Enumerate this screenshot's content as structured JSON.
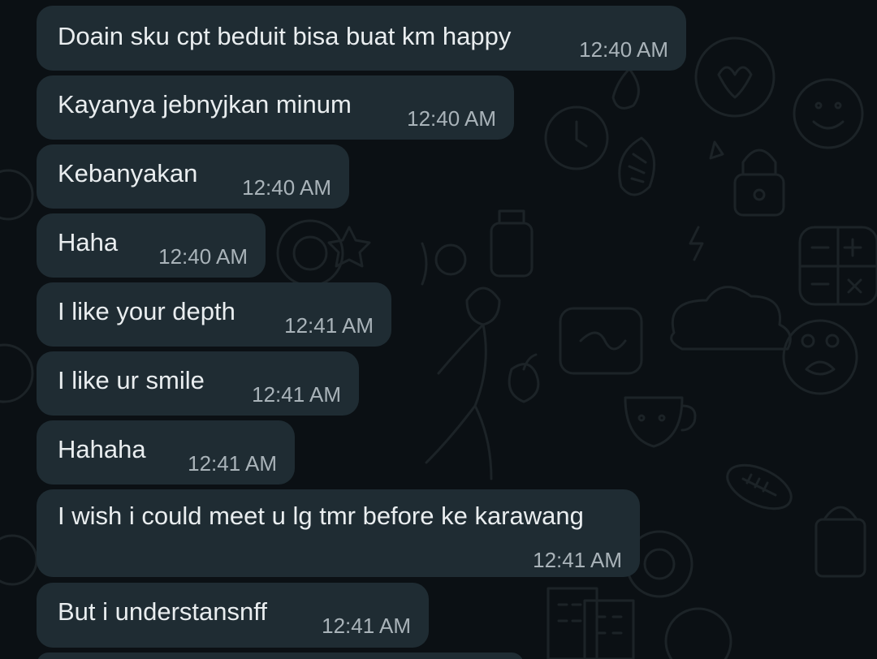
{
  "theme": {
    "background": "#0b1014",
    "bubble_incoming": "#1f2c33",
    "text": "#e9edef",
    "timestamp": "#a9b3b9"
  },
  "messages": [
    {
      "text": "Doain sku cpt beduit bisa buat km happy",
      "time": "12:40 AM",
      "direction": "incoming"
    },
    {
      "text": "Kayanya jebnyjkan minum",
      "time": "12:40 AM",
      "direction": "incoming"
    },
    {
      "text": "Kebanyakan",
      "time": "12:40 AM",
      "direction": "incoming"
    },
    {
      "text": "Haha",
      "time": "12:40 AM",
      "direction": "incoming"
    },
    {
      "text": "I like your depth",
      "time": "12:41 AM",
      "direction": "incoming"
    },
    {
      "text": "I like ur smile",
      "time": "12:41 AM",
      "direction": "incoming"
    },
    {
      "text": "Hahaha",
      "time": "12:41 AM",
      "direction": "incoming"
    },
    {
      "text": "I wish i could meet u lg tmr before ke karawang",
      "time": "12:41 AM",
      "direction": "incoming"
    },
    {
      "text": "But i understansnff",
      "time": "12:41 AM",
      "direction": "incoming"
    }
  ]
}
